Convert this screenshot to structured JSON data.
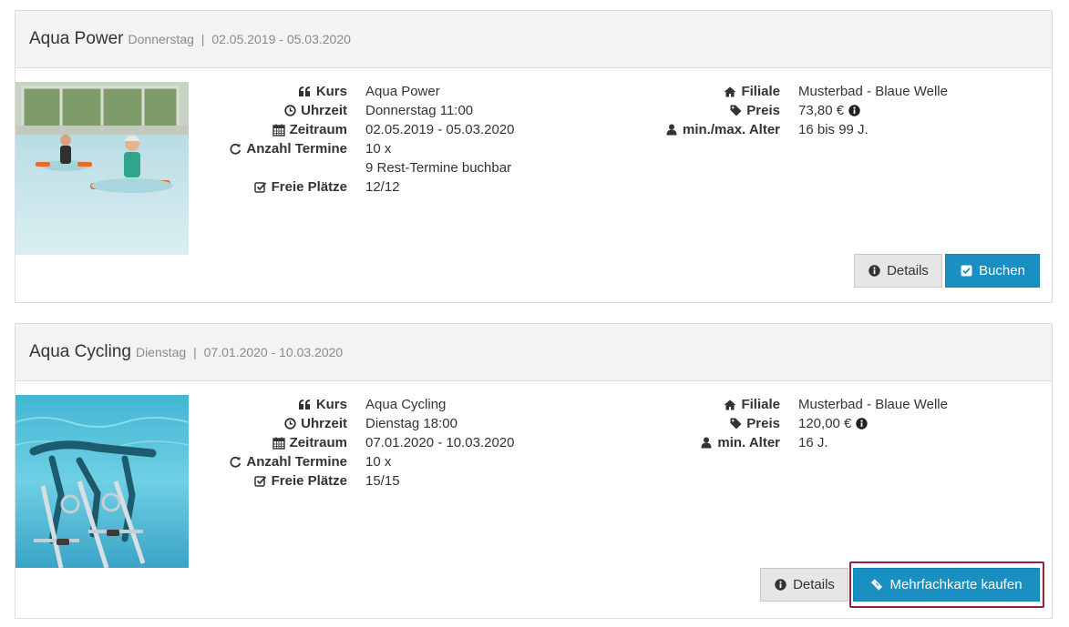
{
  "courses": [
    {
      "title": "Aqua Power",
      "weekday": "Donnerstag",
      "separator": "|",
      "period": "02.05.2019 - 05.03.2020",
      "fields": {
        "kurs_label": "Kurs",
        "kurs_value": "Aqua Power",
        "uhrzeit_label": "Uhrzeit",
        "uhrzeit_value": "Donnerstag 11:00",
        "zeitraum_label": "Zeitraum",
        "zeitraum_value": "02.05.2019 - 05.03.2020",
        "termine_label": "Anzahl Termine",
        "termine_value": "10 x",
        "rest_value": "9 Rest-Termine buchbar",
        "plaetze_label": "Freie Plätze",
        "plaetze_value": "12/12",
        "filiale_label": "Filiale",
        "filiale_value": "Musterbad - Blaue Welle",
        "preis_label": "Preis",
        "preis_value": "73,80 €",
        "alter_label": "min./max. Alter",
        "alter_value": "16 bis 99 J."
      },
      "buttons": {
        "details": "Details",
        "action": "Buchen"
      }
    },
    {
      "title": "Aqua Cycling",
      "weekday": "Dienstag",
      "separator": "|",
      "period": "07.01.2020 - 10.03.2020",
      "fields": {
        "kurs_label": "Kurs",
        "kurs_value": "Aqua Cycling",
        "uhrzeit_label": "Uhrzeit",
        "uhrzeit_value": "Dienstag 18:00",
        "zeitraum_label": "Zeitraum",
        "zeitraum_value": "07.01.2020 - 10.03.2020",
        "termine_label": "Anzahl Termine",
        "termine_value": "10 x",
        "plaetze_label": "Freie Plätze",
        "plaetze_value": "15/15",
        "filiale_label": "Filiale",
        "filiale_value": "Musterbad - Blaue Welle",
        "preis_label": "Preis",
        "preis_value": "120,00 €",
        "alter_label": "min. Alter",
        "alter_value": "16 J."
      },
      "buttons": {
        "details": "Details",
        "action": "Mehrfachkarte kaufen"
      }
    }
  ],
  "icons": {
    "kurs": "quote-icon",
    "uhrzeit": "clock-icon",
    "zeitraum": "calendar-icon",
    "termine": "refresh-icon",
    "plaetze": "checkbox-icon",
    "filiale": "home-icon",
    "preis": "tag-icon",
    "alter": "user-icon",
    "preis_info": "info-icon",
    "details": "info-icon",
    "buchen": "checkbox-icon",
    "mehrfachkarte": "ticket-icon"
  },
  "colors": {
    "primary_button": "#1a8fc2",
    "default_button": "#e6e6e6",
    "header_bg": "#f3f3f3",
    "focus_ring": "#9a1f3a"
  }
}
